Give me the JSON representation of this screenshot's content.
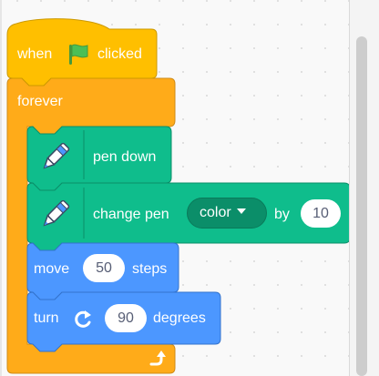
{
  "script": {
    "hat": {
      "when_text": "when",
      "clicked_text": "clicked",
      "flag_icon": "green-flag-icon"
    },
    "forever": {
      "label": "forever",
      "loop_icon": "loop-arrow-icon"
    },
    "pen_down": {
      "label": "pen down",
      "icon": "pen-icon"
    },
    "change_pen": {
      "prefix": "change pen",
      "param": "color",
      "by_text": "by",
      "value": "10",
      "icon": "pen-icon"
    },
    "move": {
      "prefix": "move",
      "value": "50",
      "suffix": "steps"
    },
    "turn": {
      "prefix": "turn",
      "value": "90",
      "suffix": "degrees",
      "icon": "rotate-right-icon"
    }
  },
  "colors": {
    "events": "#ffbf00",
    "events_border": "#cc9900",
    "control": "#ffab19",
    "control_border": "#cf8b17",
    "pen": "#0fbd8c",
    "pen_border": "#0b8e69",
    "motion": "#4c97ff",
    "motion_border": "#3373cc",
    "flag": "#4cbf56"
  }
}
